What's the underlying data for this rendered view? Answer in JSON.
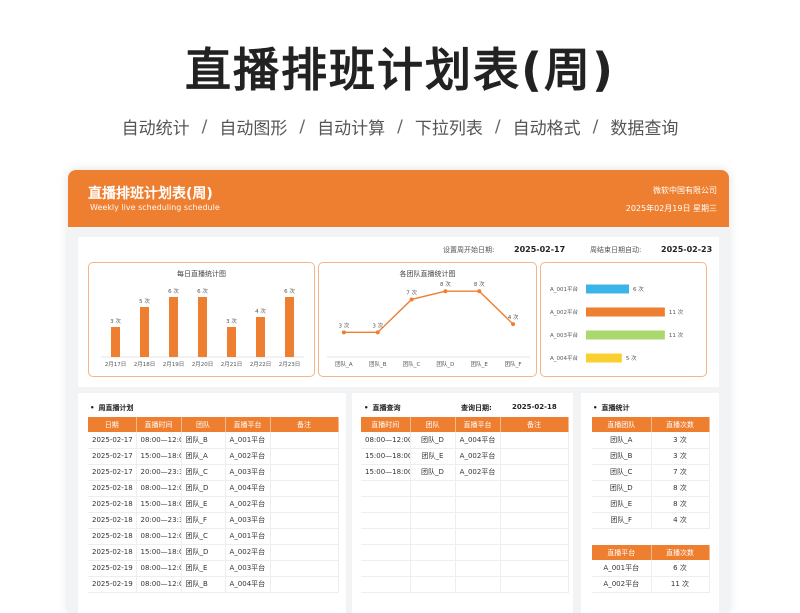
{
  "hero": {
    "title": "直播排班计划表(周)",
    "features": [
      "自动统计",
      "自动图形",
      "自动计算",
      "下拉列表",
      "自动格式",
      "数据查询"
    ]
  },
  "header": {
    "title": "直播排班计划表(周)",
    "subtitle": "Weekly live scheduling schedule",
    "company": "微软中国有限公司",
    "date": "2025年02月19日  星期三"
  },
  "dates": {
    "start_label": "设置周开始日期:",
    "start_value": "2025-02-17",
    "end_label": "周结束日期自动:",
    "end_value": "2025-02-23"
  },
  "colors": {
    "accent": "#ee7f30",
    "blue": "#3bb4ea",
    "green": "#a8d86e",
    "yellow": "#f9d02f"
  },
  "chart_data": [
    {
      "type": "bar",
      "title": "每日直播统计图",
      "categories": [
        "2月17日",
        "2月18日",
        "2月19日",
        "2月20日",
        "2月21日",
        "2月22日",
        "2月23日"
      ],
      "values": [
        3,
        5,
        6,
        6,
        3,
        4,
        6
      ],
      "data_labels": [
        "3 次",
        "5 次",
        "6 次",
        "6 次",
        "3 次",
        "4 次",
        "6 次"
      ],
      "ylim": [
        0,
        7
      ]
    },
    {
      "type": "line",
      "title": "各团队直播统计图",
      "categories": [
        "团队_A",
        "团队_B",
        "团队_C",
        "团队_D",
        "团队_E",
        "团队_F"
      ],
      "values": [
        3,
        3,
        7,
        8,
        8,
        4
      ],
      "data_labels": [
        "3 次",
        "3 次",
        "7 次",
        "8 次",
        "8 次",
        "4 次"
      ],
      "ylim": [
        0,
        9
      ]
    },
    {
      "type": "bar",
      "orientation": "horizontal",
      "categories": [
        "A_001平台",
        "A_002平台",
        "A_003平台",
        "A_004平台"
      ],
      "values": [
        6,
        11,
        11,
        5
      ],
      "data_labels": [
        "6 次",
        "11 次",
        "11 次",
        "5 次"
      ],
      "colors": [
        "#3bb4ea",
        "#ee7f30",
        "#a8d86e",
        "#f9d02f"
      ],
      "xlim": [
        0,
        12
      ]
    }
  ],
  "week_plan": {
    "title": "周直播计划",
    "columns": [
      "日期",
      "直播时间",
      "团队",
      "直播平台",
      "备注"
    ],
    "rows": [
      [
        "2025-02-17",
        "08:00—12:00",
        "团队_B",
        "A_001平台",
        ""
      ],
      [
        "2025-02-17",
        "15:00—18:00",
        "团队_A",
        "A_002平台",
        ""
      ],
      [
        "2025-02-17",
        "20:00—23:30",
        "团队_C",
        "A_003平台",
        ""
      ],
      [
        "2025-02-18",
        "08:00—12:00",
        "团队_D",
        "A_004平台",
        ""
      ],
      [
        "2025-02-18",
        "15:00—18:00",
        "团队_E",
        "A_002平台",
        ""
      ],
      [
        "2025-02-18",
        "20:00—23:30",
        "团队_F",
        "A_003平台",
        ""
      ],
      [
        "2025-02-18",
        "08:00—12:00",
        "团队_C",
        "A_001平台",
        ""
      ],
      [
        "2025-02-18",
        "15:00—18:00",
        "团队_D",
        "A_002平台",
        ""
      ],
      [
        "2025-02-19",
        "08:00—12:00",
        "团队_E",
        "A_003平台",
        ""
      ],
      [
        "2025-02-19",
        "08:00—12:00",
        "团队_B",
        "A_004平台",
        ""
      ]
    ]
  },
  "query": {
    "title": "直播查询",
    "date_label": "查询日期:",
    "date_value": "2025-02-18",
    "columns": [
      "直播时间",
      "团队",
      "直播平台",
      "备注"
    ],
    "rows": [
      [
        "08:00—12:00",
        "团队_D",
        "A_004平台",
        ""
      ],
      [
        "15:00—18:00",
        "团队_E",
        "A_002平台",
        ""
      ],
      [
        "15:00—18:00",
        "团队_D",
        "A_002平台",
        ""
      ]
    ],
    "empty_rows": 7
  },
  "stats": {
    "title": "直播统计",
    "team_columns": [
      "直播团队",
      "直播次数"
    ],
    "team_rows": [
      [
        "团队_A",
        "3 次"
      ],
      [
        "团队_B",
        "3 次"
      ],
      [
        "团队_C",
        "7 次"
      ],
      [
        "团队_D",
        "8 次"
      ],
      [
        "团队_E",
        "8 次"
      ],
      [
        "团队_F",
        "4 次"
      ]
    ],
    "platform_columns": [
      "直播平台",
      "直播次数"
    ],
    "platform_rows": [
      [
        "A_001平台",
        "6 次"
      ],
      [
        "A_002平台",
        "11 次"
      ]
    ]
  }
}
